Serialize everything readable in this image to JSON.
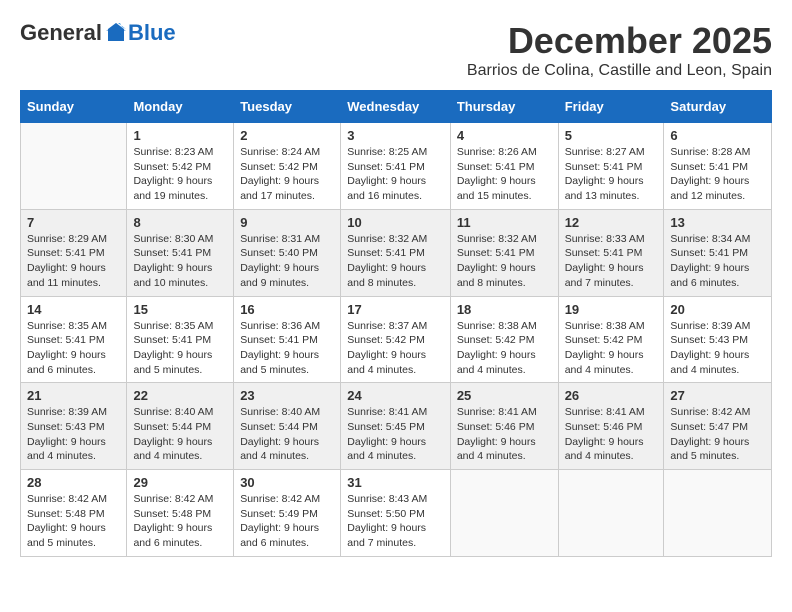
{
  "logo": {
    "general": "General",
    "blue": "Blue"
  },
  "title": "December 2025",
  "location": "Barrios de Colina, Castille and Leon, Spain",
  "days_of_week": [
    "Sunday",
    "Monday",
    "Tuesday",
    "Wednesday",
    "Thursday",
    "Friday",
    "Saturday"
  ],
  "weeks": [
    [
      {
        "day": "",
        "info": ""
      },
      {
        "day": "1",
        "info": "Sunrise: 8:23 AM\nSunset: 5:42 PM\nDaylight: 9 hours\nand 19 minutes."
      },
      {
        "day": "2",
        "info": "Sunrise: 8:24 AM\nSunset: 5:42 PM\nDaylight: 9 hours\nand 17 minutes."
      },
      {
        "day": "3",
        "info": "Sunrise: 8:25 AM\nSunset: 5:41 PM\nDaylight: 9 hours\nand 16 minutes."
      },
      {
        "day": "4",
        "info": "Sunrise: 8:26 AM\nSunset: 5:41 PM\nDaylight: 9 hours\nand 15 minutes."
      },
      {
        "day": "5",
        "info": "Sunrise: 8:27 AM\nSunset: 5:41 PM\nDaylight: 9 hours\nand 13 minutes."
      },
      {
        "day": "6",
        "info": "Sunrise: 8:28 AM\nSunset: 5:41 PM\nDaylight: 9 hours\nand 12 minutes."
      }
    ],
    [
      {
        "day": "7",
        "info": "Sunrise: 8:29 AM\nSunset: 5:41 PM\nDaylight: 9 hours\nand 11 minutes."
      },
      {
        "day": "8",
        "info": "Sunrise: 8:30 AM\nSunset: 5:41 PM\nDaylight: 9 hours\nand 10 minutes."
      },
      {
        "day": "9",
        "info": "Sunrise: 8:31 AM\nSunset: 5:40 PM\nDaylight: 9 hours\nand 9 minutes."
      },
      {
        "day": "10",
        "info": "Sunrise: 8:32 AM\nSunset: 5:41 PM\nDaylight: 9 hours\nand 8 minutes."
      },
      {
        "day": "11",
        "info": "Sunrise: 8:32 AM\nSunset: 5:41 PM\nDaylight: 9 hours\nand 8 minutes."
      },
      {
        "day": "12",
        "info": "Sunrise: 8:33 AM\nSunset: 5:41 PM\nDaylight: 9 hours\nand 7 minutes."
      },
      {
        "day": "13",
        "info": "Sunrise: 8:34 AM\nSunset: 5:41 PM\nDaylight: 9 hours\nand 6 minutes."
      }
    ],
    [
      {
        "day": "14",
        "info": "Sunrise: 8:35 AM\nSunset: 5:41 PM\nDaylight: 9 hours\nand 6 minutes."
      },
      {
        "day": "15",
        "info": "Sunrise: 8:35 AM\nSunset: 5:41 PM\nDaylight: 9 hours\nand 5 minutes."
      },
      {
        "day": "16",
        "info": "Sunrise: 8:36 AM\nSunset: 5:41 PM\nDaylight: 9 hours\nand 5 minutes."
      },
      {
        "day": "17",
        "info": "Sunrise: 8:37 AM\nSunset: 5:42 PM\nDaylight: 9 hours\nand 4 minutes."
      },
      {
        "day": "18",
        "info": "Sunrise: 8:38 AM\nSunset: 5:42 PM\nDaylight: 9 hours\nand 4 minutes."
      },
      {
        "day": "19",
        "info": "Sunrise: 8:38 AM\nSunset: 5:42 PM\nDaylight: 9 hours\nand 4 minutes."
      },
      {
        "day": "20",
        "info": "Sunrise: 8:39 AM\nSunset: 5:43 PM\nDaylight: 9 hours\nand 4 minutes."
      }
    ],
    [
      {
        "day": "21",
        "info": "Sunrise: 8:39 AM\nSunset: 5:43 PM\nDaylight: 9 hours\nand 4 minutes."
      },
      {
        "day": "22",
        "info": "Sunrise: 8:40 AM\nSunset: 5:44 PM\nDaylight: 9 hours\nand 4 minutes."
      },
      {
        "day": "23",
        "info": "Sunrise: 8:40 AM\nSunset: 5:44 PM\nDaylight: 9 hours\nand 4 minutes."
      },
      {
        "day": "24",
        "info": "Sunrise: 8:41 AM\nSunset: 5:45 PM\nDaylight: 9 hours\nand 4 minutes."
      },
      {
        "day": "25",
        "info": "Sunrise: 8:41 AM\nSunset: 5:46 PM\nDaylight: 9 hours\nand 4 minutes."
      },
      {
        "day": "26",
        "info": "Sunrise: 8:41 AM\nSunset: 5:46 PM\nDaylight: 9 hours\nand 4 minutes."
      },
      {
        "day": "27",
        "info": "Sunrise: 8:42 AM\nSunset: 5:47 PM\nDaylight: 9 hours\nand 5 minutes."
      }
    ],
    [
      {
        "day": "28",
        "info": "Sunrise: 8:42 AM\nSunset: 5:48 PM\nDaylight: 9 hours\nand 5 minutes."
      },
      {
        "day": "29",
        "info": "Sunrise: 8:42 AM\nSunset: 5:48 PM\nDaylight: 9 hours\nand 6 minutes."
      },
      {
        "day": "30",
        "info": "Sunrise: 8:42 AM\nSunset: 5:49 PM\nDaylight: 9 hours\nand 6 minutes."
      },
      {
        "day": "31",
        "info": "Sunrise: 8:43 AM\nSunset: 5:50 PM\nDaylight: 9 hours\nand 7 minutes."
      },
      {
        "day": "",
        "info": ""
      },
      {
        "day": "",
        "info": ""
      },
      {
        "day": "",
        "info": ""
      }
    ]
  ]
}
